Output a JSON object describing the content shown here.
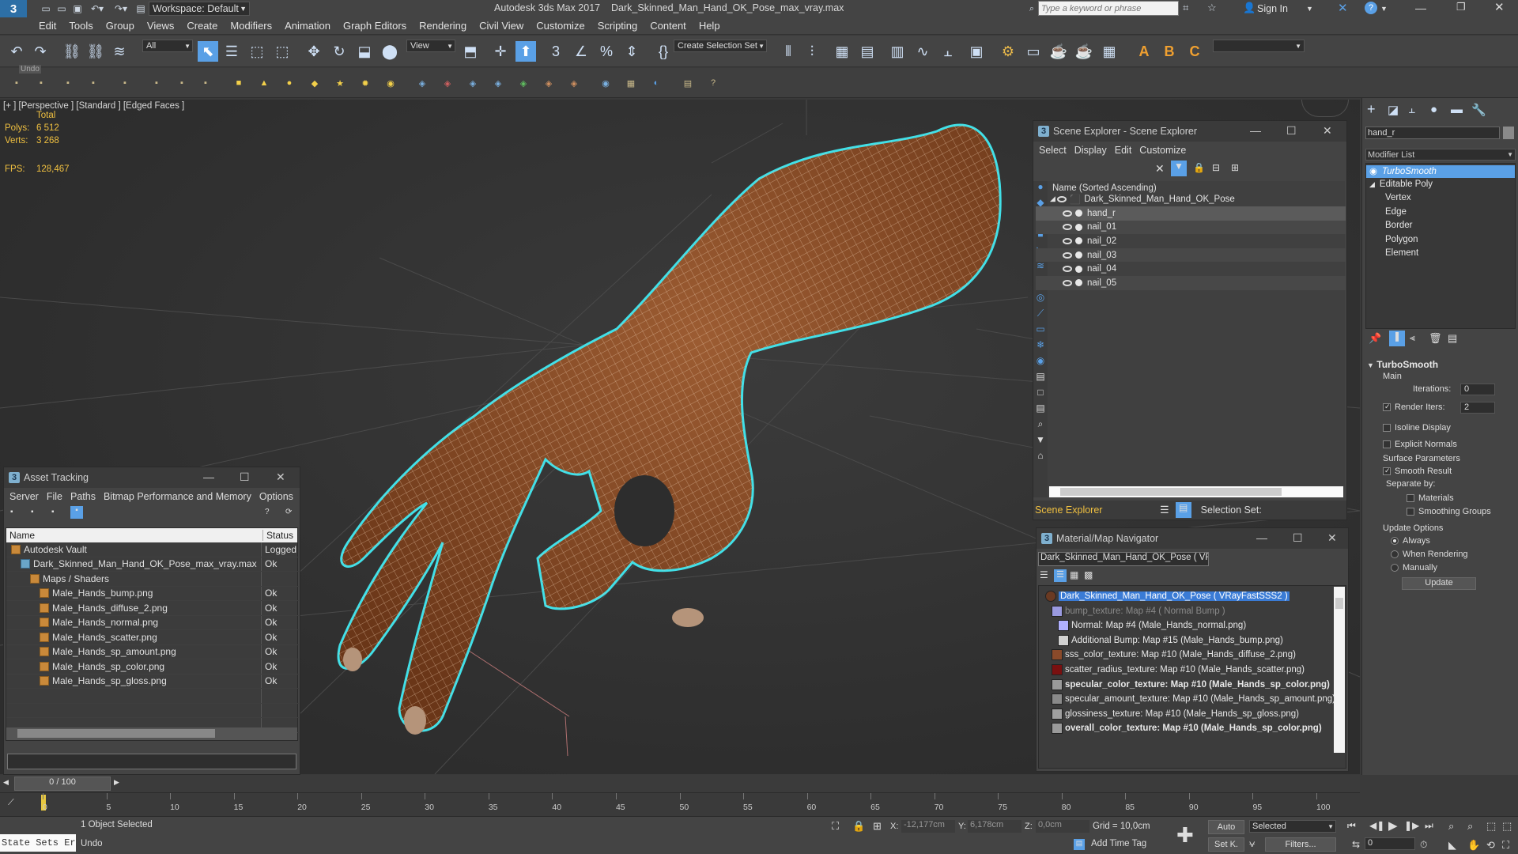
{
  "app": {
    "title": "Autodesk 3ds Max 2017",
    "file": "Dark_Skinned_Man_Hand_OK_Pose_max_vray.max",
    "workspace": "Workspace: Default",
    "search_placeholder": "Type a keyword or phrase",
    "sign_in": "Sign In"
  },
  "menu": [
    "Edit",
    "Tools",
    "Group",
    "Views",
    "Create",
    "Modifiers",
    "Animation",
    "Graph Editors",
    "Rendering",
    "Civil View",
    "Customize",
    "Scripting",
    "Content",
    "Help"
  ],
  "toolbar": {
    "filter_value": "All",
    "refcoord_value": "View",
    "selection_set": "Create Selection Set",
    "undo_tooltip": "Undo"
  },
  "viewport": {
    "label_plus": "[+ ]",
    "label_view": "[Perspective ]",
    "label_shading": "[Standard ]",
    "label_edges": "[Edged Faces ]",
    "total": "Total",
    "polys_label": "Polys:",
    "polys_value": "6 512",
    "verts_label": "Verts:",
    "verts_value": "3 268",
    "fps_label": "FPS:",
    "fps_value": "128,467"
  },
  "asset_tracking": {
    "title": "Asset Tracking",
    "menu": [
      "Server",
      "File",
      "Paths",
      "Bitmap Performance and Memory",
      "Options"
    ],
    "col_name": "Name",
    "col_status": "Status",
    "rows": [
      {
        "name": "Autodesk Vault",
        "status": "Logged",
        "indent": 0
      },
      {
        "name": "Dark_Skinned_Man_Hand_OK_Pose_max_vray.max",
        "status": "Ok",
        "indent": 1
      },
      {
        "name": "Maps / Shaders",
        "status": "",
        "indent": 2
      },
      {
        "name": "Male_Hands_bump.png",
        "status": "Ok",
        "indent": 3
      },
      {
        "name": "Male_Hands_diffuse_2.png",
        "status": "Ok",
        "indent": 3
      },
      {
        "name": "Male_Hands_normal.png",
        "status": "Ok",
        "indent": 3
      },
      {
        "name": "Male_Hands_scatter.png",
        "status": "Ok",
        "indent": 3
      },
      {
        "name": "Male_Hands_sp_amount.png",
        "status": "Ok",
        "indent": 3
      },
      {
        "name": "Male_Hands_sp_color.png",
        "status": "Ok",
        "indent": 3
      },
      {
        "name": "Male_Hands_sp_gloss.png",
        "status": "Ok",
        "indent": 3
      }
    ]
  },
  "scene_explorer": {
    "title": "Scene Explorer - Scene Explorer",
    "menu": [
      "Select",
      "Display",
      "Edit",
      "Customize"
    ],
    "col_name": "Name (Sorted Ascending)",
    "root": "Dark_Skinned_Man_Hand_OK_Pose",
    "children": [
      "hand_r",
      "nail_01",
      "nail_02",
      "nail_03",
      "nail_04",
      "nail_05"
    ],
    "footer_label": "Scene Explorer",
    "selection_set_label": "Selection Set:"
  },
  "material_navigator": {
    "title": "Material/Map Navigator",
    "current": "Dark_Skinned_Man_Hand_OK_Pose  ( VRayFa",
    "rows": [
      {
        "text": "Dark_Skinned_Man_Hand_OK_Pose  ( VRayFastSSS2 )",
        "color": "#6a3a22",
        "bold": false,
        "highlight": true,
        "dim": false,
        "indent": 0
      },
      {
        "text": "bump_texture: Map #4  ( Normal Bump )",
        "color": "#9a9ae0",
        "bold": false,
        "highlight": false,
        "dim": true,
        "indent": 1
      },
      {
        "text": "Normal: Map #4 (Male_Hands_normal.png)",
        "color": "#b0b0ff",
        "bold": false,
        "highlight": false,
        "dim": false,
        "indent": 2
      },
      {
        "text": "Additional Bump: Map #15 (Male_Hands_bump.png)",
        "color": "#d0d0d0",
        "bold": false,
        "highlight": false,
        "dim": false,
        "indent": 2
      },
      {
        "text": "sss_color_texture: Map #10 (Male_Hands_diffuse_2.png)",
        "color": "#8a4a2a",
        "bold": false,
        "highlight": false,
        "dim": false,
        "indent": 1
      },
      {
        "text": "scatter_radius_texture: Map #10 (Male_Hands_scatter.png)",
        "color": "#7a1010",
        "bold": false,
        "highlight": false,
        "dim": false,
        "indent": 1
      },
      {
        "text": "specular_color_texture: Map #10 (Male_Hands_sp_color.png)",
        "color": "#9a9a9a",
        "bold": true,
        "highlight": false,
        "dim": false,
        "indent": 1
      },
      {
        "text": "specular_amount_texture: Map #10 (Male_Hands_sp_amount.png)",
        "color": "#8a8a8a",
        "bold": false,
        "highlight": false,
        "dim": false,
        "indent": 1
      },
      {
        "text": "glossiness_texture: Map #10 (Male_Hands_sp_gloss.png)",
        "color": "#a0a0a0",
        "bold": false,
        "highlight": false,
        "dim": false,
        "indent": 1
      },
      {
        "text": "overall_color_texture: Map #10 (Male_Hands_sp_color.png)",
        "color": "#9a9a9a",
        "bold": true,
        "highlight": false,
        "dim": false,
        "indent": 1
      }
    ]
  },
  "command_panel": {
    "object_name": "hand_r",
    "modifier_list": "Modifier List",
    "stack": [
      {
        "label": "TurboSmooth",
        "level": 0,
        "selected": true
      },
      {
        "label": "Editable Poly",
        "level": 0,
        "selected": false
      },
      {
        "label": "Vertex",
        "level": 1,
        "selected": false
      },
      {
        "label": "Edge",
        "level": 1,
        "selected": false
      },
      {
        "label": "Border",
        "level": 1,
        "selected": false
      },
      {
        "label": "Polygon",
        "level": 1,
        "selected": false
      },
      {
        "label": "Element",
        "level": 1,
        "selected": false
      }
    ],
    "rollout": {
      "title": "TurboSmooth",
      "main": "Main",
      "iterations_label": "Iterations:",
      "iterations_value": "0",
      "render_iters_label": "Render Iters:",
      "render_iters_value": "2",
      "isoline": "Isoline Display",
      "explicit_normals": "Explicit Normals",
      "surface_params": "Surface Parameters",
      "smooth_result": "Smooth Result",
      "separate_by": "Separate by:",
      "materials": "Materials",
      "smoothing_groups": "Smoothing Groups",
      "update_options": "Update Options",
      "always": "Always",
      "when_rendering": "When Rendering",
      "manually": "Manually",
      "update_button": "Update"
    }
  },
  "timeline": {
    "frame": "0 / 100",
    "ticks": [
      "0",
      "5",
      "10",
      "15",
      "20",
      "25",
      "30",
      "35",
      "40",
      "45",
      "50",
      "55",
      "60",
      "65",
      "70",
      "75",
      "80",
      "85",
      "90",
      "95",
      "100"
    ]
  },
  "status": {
    "maxscript": "State Sets Er",
    "selected": "1 Object Selected",
    "prompt": "Undo",
    "x_label": "X:",
    "x_value": "-12,177cm",
    "y_label": "Y:",
    "y_value": "6,178cm",
    "z_label": "Z:",
    "z_value": "0,0cm",
    "grid": "Grid = 10,0cm",
    "add_time_tag": "Add Time Tag",
    "auto": "Auto",
    "set_k": "Set K.",
    "selected_dropdown": "Selected",
    "filters": "Filters...",
    "frame_value": "0"
  },
  "colors": {
    "accent": "#5aa0e6",
    "selection_outline": "#40e0e8",
    "skin": "#8a4e2a"
  }
}
